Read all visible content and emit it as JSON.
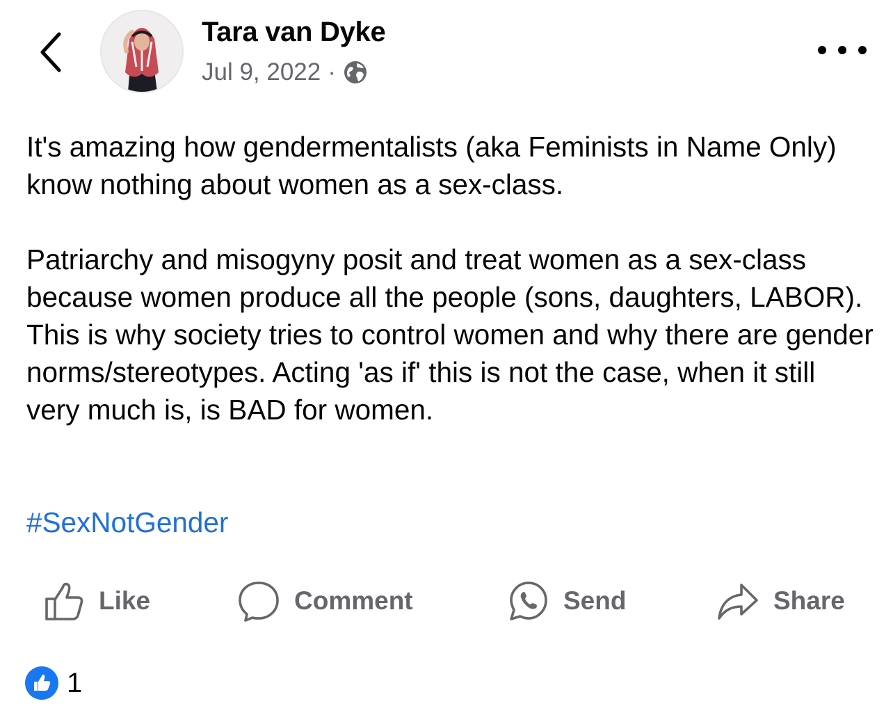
{
  "post": {
    "author": "Tara van Dyke",
    "date": "Jul 9, 2022",
    "separator": "·",
    "privacy_icon": "globe-icon",
    "paragraphs": [
      "It's amazing how gendermentalists (aka Feminists in Name Only) know nothing about women as a sex-class.",
      "Patriarchy and misogyny posit and treat women as a sex-class because women produce all the people (sons, daughters, LABOR). This is why society tries to control women and why there are gender norms/stereotypes. Acting 'as if' this is not the case, when it still very much is, is BAD for women."
    ],
    "hashtag": "#SexNotGender"
  },
  "actions": {
    "like": "Like",
    "comment": "Comment",
    "send": "Send",
    "share": "Share"
  },
  "reactions": {
    "icon": "like-reaction-icon",
    "count": "1"
  },
  "colors": {
    "text": "#050505",
    "secondary": "#65676b",
    "link": "#216fdb",
    "like_blue": "#1877f2"
  }
}
